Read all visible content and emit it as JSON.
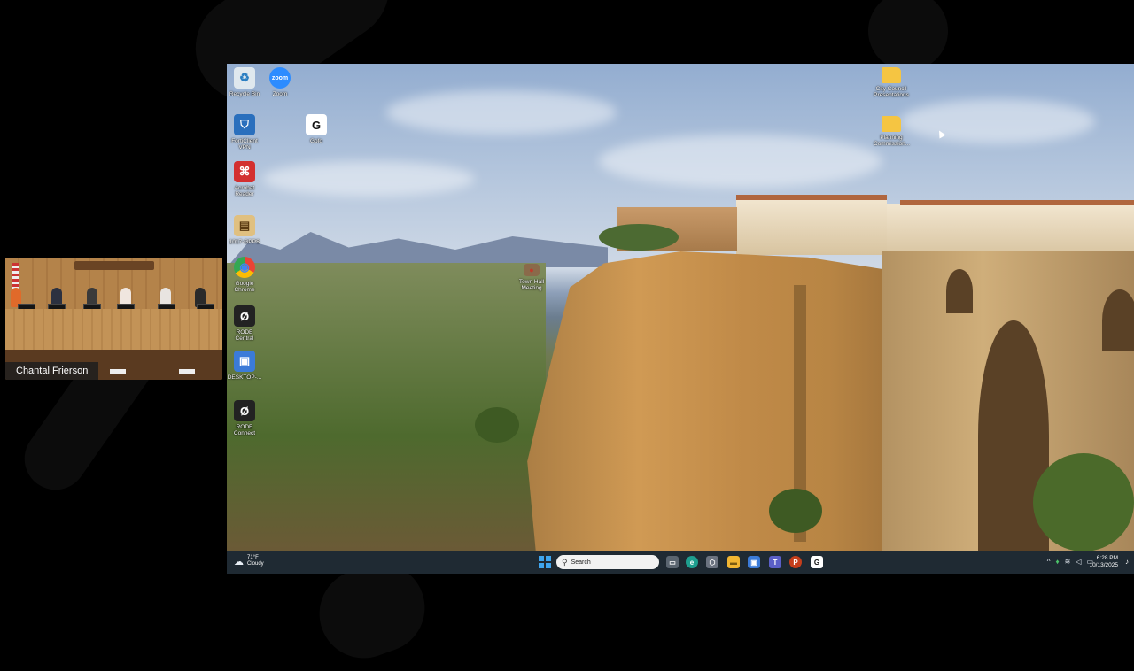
{
  "participant": {
    "name": "Chantal Frierson"
  },
  "desktop": {
    "icons": [
      {
        "id": "recycle-bin",
        "label": "Recycle Bin",
        "glyph": "♻",
        "color": "#dfe8ee"
      },
      {
        "id": "zoom",
        "label": "Zoom",
        "glyph": "zoom",
        "color": "#2d8cff"
      },
      {
        "id": "fortinet-vpn",
        "label": "FortiClient VPN",
        "glyph": "⛉",
        "color": "#2a6fbd"
      },
      {
        "id": "gofo",
        "label": "Gofo",
        "glyph": "G",
        "color": "#ffffff"
      },
      {
        "id": "acrobat",
        "label": "Acrobat Reader",
        "glyph": "⌘",
        "color": "#d32f2f"
      },
      {
        "id": "gpps",
        "label": "1017-GPPS",
        "glyph": "▤",
        "color": "#e0c080"
      },
      {
        "id": "chrome",
        "label": "Google Chrome",
        "glyph": "◉",
        "color": "#4285f4"
      },
      {
        "id": "rode-central",
        "label": "RODE Central",
        "glyph": "Ø",
        "color": "#222222"
      },
      {
        "id": "desktop-shortcut",
        "label": "DESKTOP-...",
        "glyph": "▣",
        "color": "#3b7bd8"
      },
      {
        "id": "rode-connect",
        "label": "RODE Connect",
        "glyph": "Ø",
        "color": "#222222"
      },
      {
        "id": "town-hall",
        "label": "Town Hall Meeting",
        "glyph": "●",
        "color": "#c0392b"
      },
      {
        "id": "city-council",
        "label": "City Council Presentations",
        "glyph": "",
        "color": "#f5c542"
      },
      {
        "id": "planning",
        "label": "Planning Commission...",
        "glyph": "",
        "color": "#f5c542"
      }
    ]
  },
  "taskbar": {
    "weather_temp": "71°F",
    "weather_cond": "Cloudy",
    "search_placeholder": "Search",
    "apps": [
      {
        "id": "task-view",
        "glyph": "▭",
        "color": "#5a6570"
      },
      {
        "id": "edge",
        "glyph": "e",
        "color": "#1e9e8f"
      },
      {
        "id": "copilot",
        "glyph": "⬡",
        "color": "#6b7380"
      },
      {
        "id": "file-explorer",
        "glyph": "▬",
        "color": "#f2b632"
      },
      {
        "id": "remote-desktop",
        "glyph": "▣",
        "color": "#3b7bd8"
      },
      {
        "id": "teams",
        "glyph": "T",
        "color": "#5b5fc7"
      },
      {
        "id": "powerpoint",
        "glyph": "P",
        "color": "#c43e1c"
      },
      {
        "id": "gofo",
        "glyph": "G",
        "color": "#ffffff"
      }
    ],
    "time": "6:28 PM",
    "date": "10/13/2025"
  }
}
